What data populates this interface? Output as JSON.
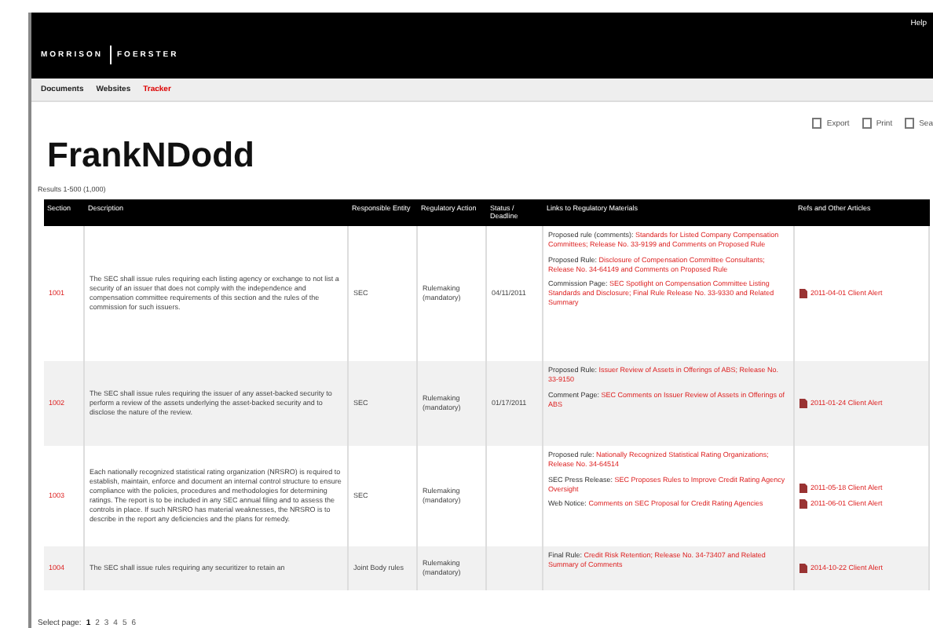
{
  "header": {
    "logo_left": "MORRISON",
    "logo_right": "FOERSTER",
    "help": "Help"
  },
  "nav": [
    {
      "label": "Documents",
      "selected": false
    },
    {
      "label": "Websites",
      "selected": false
    },
    {
      "label": "Tracker",
      "selected": true
    }
  ],
  "toolbar": [
    "Export",
    "Print",
    "Sea"
  ],
  "title": "FrankNDodd",
  "results": "Results 1-500 (1,000)",
  "table": {
    "columns": [
      "Section",
      "Description",
      "Responsible Entity",
      "Regulatory Action",
      "Status / Deadline",
      "Links to Regulatory Materials",
      "Refs and Other Articles"
    ],
    "rows": [
      {
        "section": "1001",
        "description": "The SEC shall issue rules requiring each listing agency or exchange to not list a security of an issuer that does not comply with the independence and compensation committee requirements of this section and the rules of the commission for such issuers.",
        "entity": "SEC",
        "action": "Rulemaking (mandatory)",
        "status": "04/11/2011",
        "links": [
          {
            "label": "Proposed rule (comments):",
            "text": "Standards for Listed Company Compensation Committees; Release No. 33-9199 and Comments on Proposed Rule"
          },
          {
            "label": "Proposed Rule:",
            "text": "Disclosure of Compensation Committee Consultants; Release No. 34-64149 and Comments on Proposed Rule"
          },
          {
            "label": "Commission Page:",
            "text": "SEC Spotlight on Compensation Committee Listing Standards and Disclosure; Final Rule Release No. 33-9330 and Related Summary"
          }
        ],
        "refs": [
          "2011-04-01 Client Alert"
        ]
      },
      {
        "section": "1002",
        "description": "The SEC shall issue rules requiring the issuer of any asset-backed security to perform a review of the assets underlying the asset-backed security and to disclose the nature of the review.",
        "entity": "SEC",
        "action": "Rulemaking (mandatory)",
        "status": "01/17/2011",
        "links": [
          {
            "label": "Proposed Rule:",
            "text": "Issuer Review of Assets in Offerings of ABS; Release No. 33-9150"
          },
          {
            "label": "Comment Page:",
            "text": "SEC Comments on Issuer Review of Assets in Offerings of ABS"
          }
        ],
        "refs": [
          "2011-01-24 Client Alert"
        ]
      },
      {
        "section": "1003",
        "description": "Each nationally recognized statistical rating organization (NRSRO) is required to establish, maintain, enforce and document an internal control structure to ensure compliance with the policies, procedures and methodologies for determining ratings. The report is to be included in any SEC annual filing and to assess the controls in place. If such NRSRO has material weaknesses, the NRSRO is to describe in the report any deficiencies and the plans for remedy.",
        "entity": "SEC",
        "action": "Rulemaking (mandatory)",
        "status": "",
        "links": [
          {
            "label": "Proposed rule:",
            "text": "Nationally Recognized Statistical Rating Organizations; Release No. 34-64514"
          },
          {
            "label": "SEC Press Release:",
            "text": "SEC Proposes Rules to Improve Credit Rating Agency Oversight"
          },
          {
            "label": "Web Notice:",
            "text": "Comments on SEC Proposal for Credit Rating Agencies"
          }
        ],
        "refs": [
          "2011-05-18 Client Alert",
          "2011-06-01 Client Alert"
        ]
      },
      {
        "section": "1004",
        "description": "The SEC shall issue rules requiring any securitizer to retain an",
        "entity": "Joint Body rules",
        "action": "Rulemaking (mandatory)",
        "status": "",
        "links": [
          {
            "label": "Final Rule:",
            "text": "Credit Risk Retention; Release No. 34-73407 and Related Summary of Comments"
          }
        ],
        "refs": [
          "2014-10-22 Client Alert"
        ]
      }
    ]
  },
  "pagination": {
    "label": "Select page:",
    "pages": [
      {
        "label": "1",
        "selected": true
      },
      {
        "label": "2",
        "selected": false
      },
      {
        "label": "3",
        "selected": false
      },
      {
        "label": "4",
        "selected": false
      },
      {
        "label": "5",
        "selected": false
      },
      {
        "label": "6",
        "selected": false
      }
    ]
  }
}
